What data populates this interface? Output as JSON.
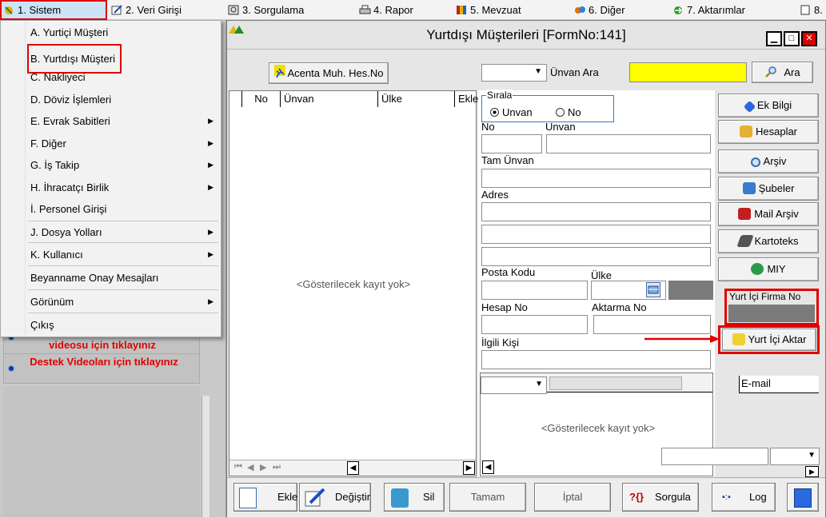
{
  "menubar": {
    "items": [
      {
        "label": "1. Sistem"
      },
      {
        "label": "2. Veri Girişi"
      },
      {
        "label": "3. Sorgulama"
      },
      {
        "label": "4. Rapor"
      },
      {
        "label": "5. Mevzuat"
      },
      {
        "label": "6. Diğer"
      },
      {
        "label": "7. Aktarımlar"
      },
      {
        "label": "8."
      }
    ]
  },
  "dropdown": {
    "items": [
      {
        "label": "A. Yurtiçi Müşteri"
      },
      {
        "label": "B. Yurtdışı Müşteri"
      },
      {
        "label": "C. Nakliyeci"
      },
      {
        "label": "D. Döviz İşlemleri"
      },
      {
        "label": "E. Evrak Sabitleri"
      },
      {
        "label": "F. Diğer"
      },
      {
        "label": "G. İş Takip"
      },
      {
        "label": "H. İhracatçı Birlik"
      },
      {
        "label": "İ. Personel Girişi"
      },
      {
        "label": "J. Dosya Yolları"
      },
      {
        "label": "K. Kullanıcı"
      },
      {
        "label": "Beyanname Onay Mesajları"
      },
      {
        "label": "Görünüm"
      },
      {
        "label": "Çıkış"
      }
    ]
  },
  "left_panel": {
    "video1": "videosu için tıklayınız",
    "video2": "Destek Videoları için tıklayınız"
  },
  "form": {
    "title": "Yurtdışı Müşterileri [FormNo:141]",
    "acenta_button": "Acenta Muh. Hes.No",
    "unvan_ara_label": "Ünvan Ara",
    "ara_button": "Ara",
    "grid_columns": [
      "No",
      "Ünvan",
      "Ülke",
      "Ekle"
    ],
    "empty_text": "<Gösterilecek kayıt yok>",
    "sirala": {
      "legend": "Sırala",
      "options": [
        "Unvan",
        "No"
      ],
      "selected": "Unvan"
    },
    "labels": {
      "no": "No",
      "unvan": "Unvan",
      "tam_unvan": "Tam Ünvan",
      "adres": "Adres",
      "posta_kodu": "Posta Kodu",
      "ulke": "Ülke",
      "hesap_no": "Hesap No",
      "aktarma_no": "Aktarma No",
      "ilgili_kisi": "İlgili Kişi",
      "yurt_ici_firma_no": "Yurt İçi Firma No",
      "email": "E-mail"
    },
    "side_buttons": [
      {
        "label": "Ek Bilgi"
      },
      {
        "label": "Hesaplar"
      },
      {
        "label": "Arşiv"
      },
      {
        "label": "Şubeler"
      },
      {
        "label": "Mail Arşiv"
      },
      {
        "label": "Kartoteks"
      },
      {
        "label": "MIY"
      }
    ],
    "yurt_ici_aktar": "Yurt İçi Aktar",
    "bottom_toolbar": [
      {
        "label": "Ekle"
      },
      {
        "label": "Değiştir"
      },
      {
        "label": "Sil"
      },
      {
        "label": "Tamam"
      },
      {
        "label": "İptal"
      },
      {
        "label": "Sorgula"
      },
      {
        "label": "Log"
      }
    ],
    "nav_buttons": [
      "⏮",
      "◀",
      "▶",
      "⏭"
    ]
  },
  "colors": {
    "highlight_red": "#e00000",
    "search_yellow": "#ffff00",
    "menu_active_bg": "#cce4f7"
  }
}
